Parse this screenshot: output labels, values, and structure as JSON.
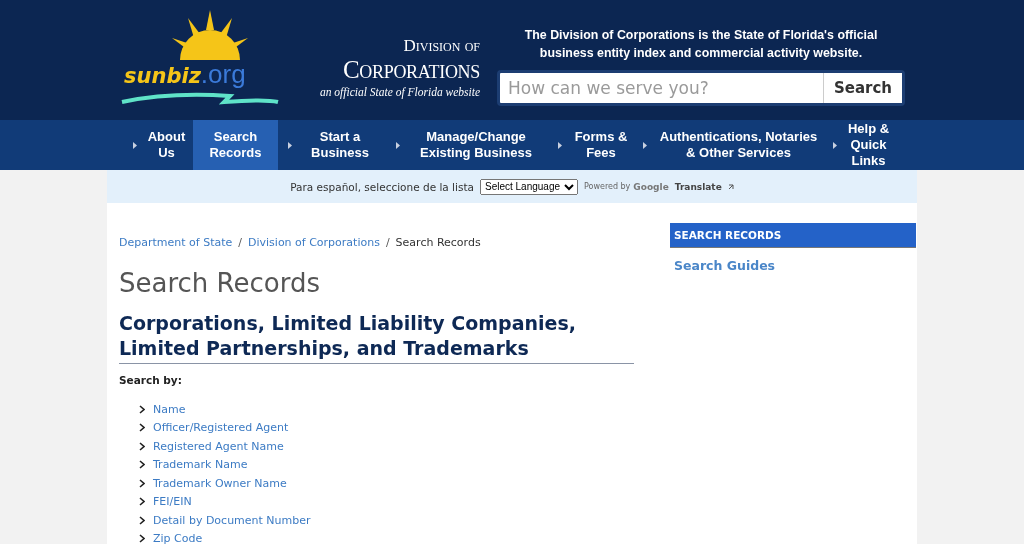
{
  "header": {
    "logo_word": "sunbiz",
    "logo_suffix": ".org",
    "division_of": "Division of",
    "corporations": "Corporations",
    "tagline": "an official State of Florida website",
    "description": "The Division of Corporations is the State of Florida's official business entity index and commercial activity website.",
    "search": {
      "placeholder": "How can we serve you?",
      "button": "Search"
    }
  },
  "nav": [
    {
      "label": "About Us",
      "selected": false
    },
    {
      "label": "Search Records",
      "selected": true
    },
    {
      "label": "Start a Business",
      "selected": false
    },
    {
      "label": "Manage/Change Existing Business",
      "selected": false
    },
    {
      "label": "Forms & Fees",
      "selected": false
    },
    {
      "label": "Authentications, Notaries & Other Services",
      "selected": false
    },
    {
      "label": "Help & Quick Links",
      "selected": false
    }
  ],
  "translate": {
    "prompt": "Para español, seleccione de la lista",
    "select": "Select Language",
    "powered_by": "Powered by",
    "google": "Google",
    "translate": "Translate"
  },
  "breadcrumb": [
    {
      "label": "Department of State",
      "kind": "link"
    },
    {
      "separator": "/",
      "label": "Division of Corporations",
      "kind": "link"
    },
    {
      "separator": "/",
      "label": "Search Records",
      "kind": "current"
    }
  ],
  "title": "Search Records",
  "subtitle": "Corporations, Limited Liability Companies, Limited Partnerships, and Trademarks",
  "search_by": "Search by:",
  "links": [
    "Name",
    "Officer/Registered Agent",
    "Registered Agent Name",
    "Trademark Name",
    "Trademark Owner Name",
    "FEI/EIN",
    "Detail by Document Number",
    "Zip Code"
  ],
  "sidebar": {
    "heading": "SEARCH RECORDS",
    "items": [
      "Search Guides"
    ]
  }
}
